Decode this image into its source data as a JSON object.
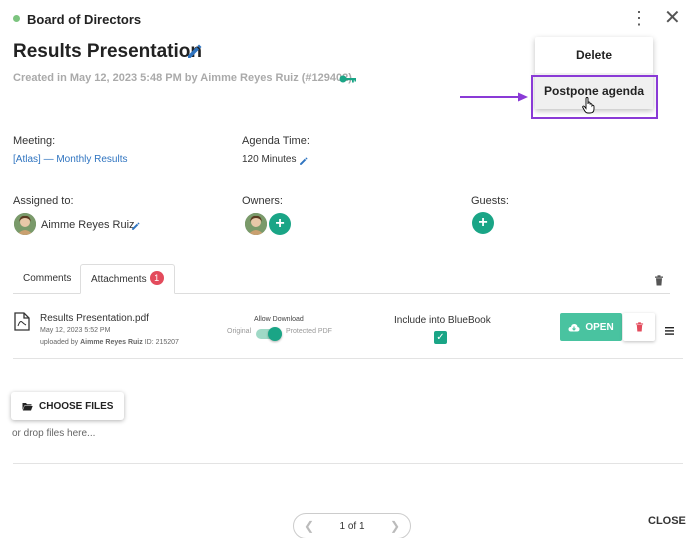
{
  "header": {
    "board_name": "Board of Directors"
  },
  "agenda": {
    "title": "Results Presentation",
    "created_meta": "Created in May 12, 2023 5:48 PM by Aimme Reyes Ruiz (#129402)"
  },
  "details": {
    "meeting_label": "Meeting:",
    "meeting_value": "[Atlas] — Monthly Results",
    "agenda_time_label": "Agenda Time:",
    "agenda_time_value": "120 Minutes",
    "assigned_label": "Assigned to:",
    "assigned_name": "Aimme Reyes Ruiz",
    "owners_label": "Owners:",
    "guests_label": "Guests:"
  },
  "tabs": [
    {
      "label": "Comments"
    },
    {
      "label": "Attachments",
      "badge": "1"
    }
  ],
  "attachment": {
    "file_name": "Results Presentation.pdf",
    "file_date": "May 12, 2023 5:52 PM",
    "uploaded_by_prefix": "uploaded by",
    "uploaded_by_name": "Aimme Reyes Ruiz",
    "file_id": "ID: 215207",
    "allow_download_label": "Allow Download",
    "toggle_left": "Original",
    "toggle_right": "Protected PDF",
    "bluebook_label": "Include into BlueBook",
    "bluebook_checked": true,
    "open_label": "OPEN"
  },
  "upload": {
    "choose_label": "CHOOSE FILES",
    "drop_text": "or drop files here..."
  },
  "pagination": {
    "text": "1 of 1"
  },
  "footer": {
    "close_label": "CLOSE"
  },
  "menu": {
    "items": [
      {
        "label": "Delete"
      },
      {
        "label": "Postpone agenda"
      }
    ]
  },
  "colors": {
    "accent": "#1aa586",
    "link": "#2f74c0",
    "badge": "#e34b5c",
    "highlight": "#8a3ad6"
  }
}
